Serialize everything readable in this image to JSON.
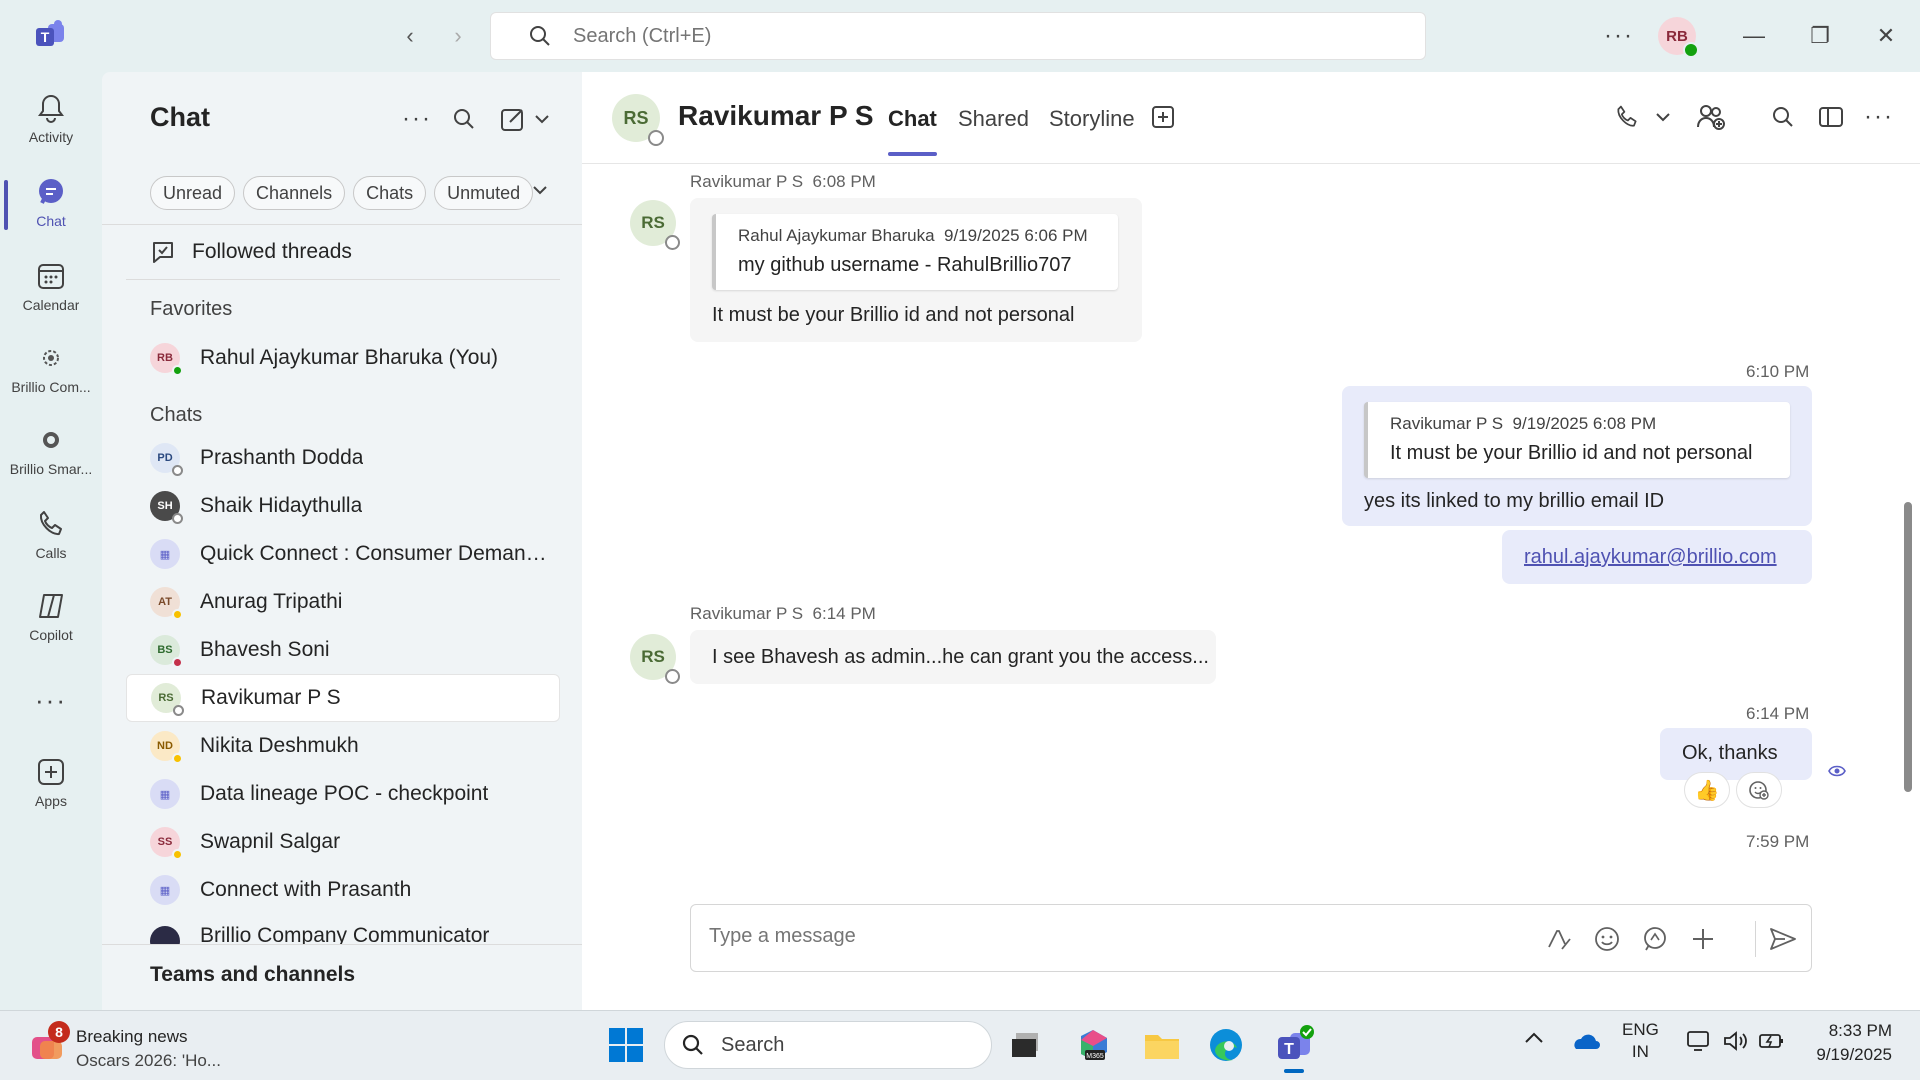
{
  "titlebar": {
    "search_placeholder": "Search (Ctrl+E)",
    "user_initials": "RB"
  },
  "rail": {
    "items": [
      {
        "label": "Activity",
        "icon": "bell-icon"
      },
      {
        "label": "Chat",
        "icon": "chat-icon",
        "active": true
      },
      {
        "label": "Calendar",
        "icon": "calendar-icon"
      },
      {
        "label": "Brillio Com...",
        "icon": "brillio-communicator-icon"
      },
      {
        "label": "Brillio Smar...",
        "icon": "brillio-smart-icon"
      },
      {
        "label": "Calls",
        "icon": "phone-icon"
      },
      {
        "label": "Copilot",
        "icon": "copilot-icon"
      },
      {
        "label": "Apps",
        "icon": "apps-icon"
      }
    ]
  },
  "listpane": {
    "title": "Chat",
    "filters": [
      "Unread",
      "Channels",
      "Chats",
      "Unmuted"
    ],
    "followed_threads": "Followed threads",
    "favorites_header": "Favorites",
    "favorites": [
      {
        "initials": "RB",
        "name": "Rahul Ajaykumar Bharuka (You)",
        "status": "available"
      }
    ],
    "chats_header": "Chats",
    "chats": [
      {
        "initials": "PD",
        "name": "Prashanth Dodda",
        "status": "offline"
      },
      {
        "initials": "SH",
        "name": "Shaik Hidaythulla",
        "status": "offline"
      },
      {
        "initials": "",
        "name": "Quick Connect : Consumer Demand ...",
        "status": "meeting"
      },
      {
        "initials": "AT",
        "name": "Anurag Tripathi",
        "status": "away"
      },
      {
        "initials": "BS",
        "name": "Bhavesh Soni",
        "status": "busy"
      },
      {
        "initials": "RS",
        "name": "Ravikumar P S",
        "status": "offline",
        "selected": true
      },
      {
        "initials": "ND",
        "name": "Nikita Deshmukh",
        "status": "away"
      },
      {
        "initials": "",
        "name": "Data lineage POC - checkpoint",
        "status": "meeting"
      },
      {
        "initials": "SS",
        "name": "Swapnil Salgar",
        "status": "away"
      },
      {
        "initials": "",
        "name": "Connect with Prasanth",
        "status": "meeting"
      },
      {
        "initials": "",
        "name": "Brillio Company Communicator",
        "status": "app"
      }
    ],
    "teams_footer": "Teams and channels"
  },
  "conversation": {
    "contact_initials": "RS",
    "contact_name": "Ravikumar P S",
    "tabs": [
      "Chat",
      "Shared",
      "Storyline"
    ],
    "messages": {
      "m1": {
        "sender": "Ravikumar P S",
        "time": "6:08 PM",
        "quote_author": "Rahul Ajaykumar Bharuka",
        "quote_time": "9/19/2025 6:06 PM",
        "quote_text": "my github username - RahulBrillio707",
        "text": "It must be your Brillio id and not personal"
      },
      "m2": {
        "time": "6:10 PM",
        "quote_author": "Ravikumar P S",
        "quote_time": "9/19/2025 6:08 PM",
        "quote_text": "It must be your Brillio id and not personal",
        "text": "yes its linked to my brillio email ID",
        "link": "rahul.ajaykumar@brillio.com"
      },
      "m3": {
        "sender": "Ravikumar P S",
        "time": "6:14 PM",
        "text": "I see Bhavesh as admin...he can grant you the access..."
      },
      "m4": {
        "time": "6:14 PM",
        "text": "Ok, thanks",
        "reaction": "👍"
      },
      "m5": {
        "time": "7:59 PM"
      }
    },
    "composer_placeholder": "Type a message"
  },
  "taskbar": {
    "news_badge": "8",
    "news_title": "Breaking news",
    "news_subtitle": "Oscars 2026: 'Ho...",
    "search_label": "Search",
    "lang_1": "ENG",
    "lang_2": "IN",
    "time": "8:33 PM",
    "date": "9/19/2025"
  },
  "colors": {
    "accent": "#5b5fc7",
    "available": "#13a10e",
    "busy": "#c4314b",
    "away": "#f8c100"
  }
}
